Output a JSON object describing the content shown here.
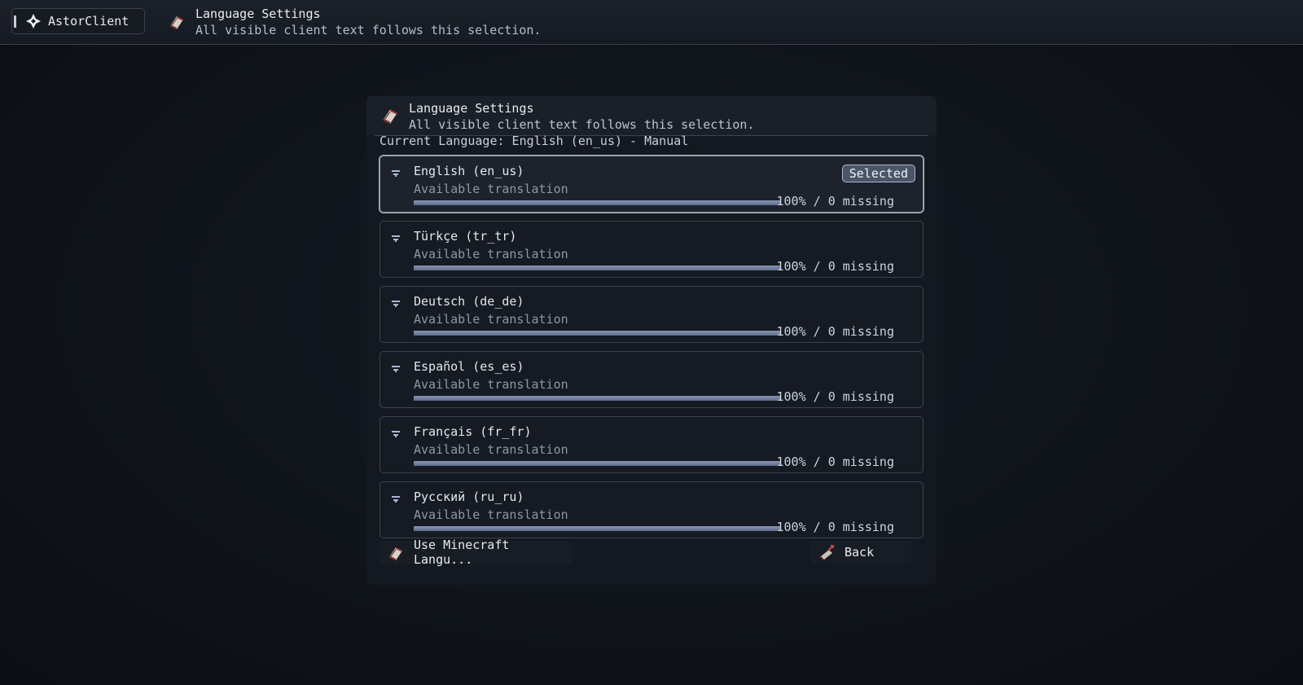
{
  "topbar": {
    "brand_name": "AstorClient",
    "brand_icon": "diamond-star-icon",
    "title": "Language Settings",
    "subtitle": "All visible client text follows this selection."
  },
  "panel": {
    "title": "Language Settings",
    "subtitle": "All visible client text follows this selection.",
    "current_language": "Current Language: English (en_us) - Manual",
    "selected_badge": "Selected",
    "languages": [
      {
        "name": "English (en_us)",
        "status": "Available translation",
        "progress": 1.0,
        "progress_label": "100% / 0 missing",
        "selected": true
      },
      {
        "name": "Türkçe (tr_tr)",
        "status": "Available translation",
        "progress": 1.0,
        "progress_label": "100% / 0 missing",
        "selected": false
      },
      {
        "name": "Deutsch (de_de)",
        "status": "Available translation",
        "progress": 1.0,
        "progress_label": "100% / 0 missing",
        "selected": false
      },
      {
        "name": "Español (es_es)",
        "status": "Available translation",
        "progress": 1.0,
        "progress_label": "100% / 0 missing",
        "selected": false
      },
      {
        "name": "Français (fr_fr)",
        "status": "Available translation",
        "progress": 1.0,
        "progress_label": "100% / 0 missing",
        "selected": false
      },
      {
        "name": "Русский (ru_ru)",
        "status": "Available translation",
        "progress": 1.0,
        "progress_label": "100% / 0 missing",
        "selected": false
      }
    ],
    "use_minecraft_button": "Use Minecraft Langu...",
    "back_button": "Back"
  },
  "colors": {
    "accent": "#8795b3",
    "background": "#0e1117",
    "panel": "#141820"
  }
}
